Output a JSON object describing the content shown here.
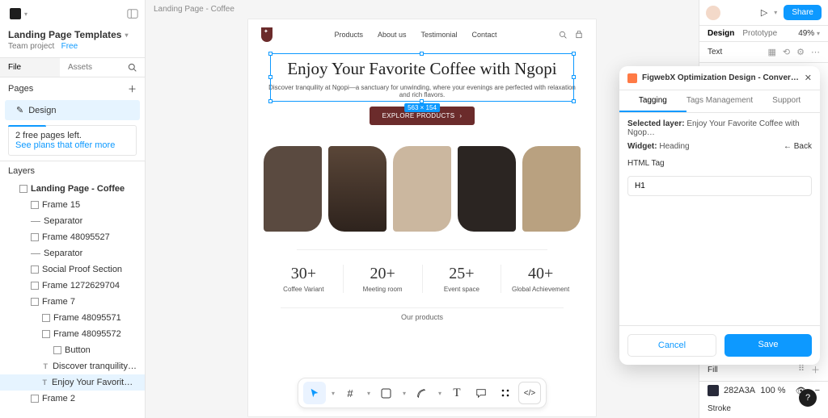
{
  "left": {
    "project_title": "Landing Page Templates",
    "team_label": "Team project",
    "free_label": "Free",
    "file_tab": "File",
    "assets_tab": "Assets",
    "pages_label": "Pages",
    "page_item": "Design",
    "notice_line1": "2 free pages left.",
    "notice_link": "See plans that offer more",
    "layers_label": "Layers",
    "layers": [
      {
        "label": "Landing Page - Coffee",
        "depth": 0,
        "icon": "frame",
        "sel": false,
        "bold": true
      },
      {
        "label": "Frame 15",
        "depth": 1,
        "icon": "frame"
      },
      {
        "label": "Separator",
        "depth": 1,
        "icon": "sep"
      },
      {
        "label": "Frame 48095527",
        "depth": 1,
        "icon": "frame"
      },
      {
        "label": "Separator",
        "depth": 1,
        "icon": "sep"
      },
      {
        "label": "Social Proof Section",
        "depth": 1,
        "icon": "frame"
      },
      {
        "label": "Frame 1272629704",
        "depth": 1,
        "icon": "frame"
      },
      {
        "label": "Frame 7",
        "depth": 1,
        "icon": "frame"
      },
      {
        "label": "Frame 48095571",
        "depth": 2,
        "icon": "frame"
      },
      {
        "label": "Frame 48095572",
        "depth": 2,
        "icon": "frame"
      },
      {
        "label": "Button",
        "depth": 3,
        "icon": "frame"
      },
      {
        "label": "Discover tranquility at Ngopi",
        "depth": 3,
        "icon": "text"
      },
      {
        "label": "Enjoy Your Favorite Coffee w",
        "depth": 3,
        "icon": "text",
        "sel": true
      },
      {
        "label": "Frame 2",
        "depth": 1,
        "icon": "frame"
      }
    ]
  },
  "canvas": {
    "tab": "Landing Page - Coffee",
    "nav": [
      "Products",
      "About us",
      "Testimonial",
      "Contact"
    ],
    "hero_title": "Enjoy Your Favorite Coffee with Ngopi",
    "sel_dim": "563 × 154",
    "hero_sub": "Discover tranquility at Ngopi—a sanctuary for unwinding, where your evenings are perfected with relaxation and rich flavors.",
    "cta": "EXPLORE PRODUCTS",
    "stats": [
      {
        "n": "30+",
        "l": "Coffee Variant"
      },
      {
        "n": "20+",
        "l": "Meeting room"
      },
      {
        "n": "25+",
        "l": "Event space"
      },
      {
        "n": "40+",
        "l": "Global Achievement"
      }
    ],
    "our_products": "Our products",
    "toolbar_icons": [
      "cursor",
      "frame",
      "square",
      "pen",
      "text",
      "comment",
      "plugins",
      "dev"
    ]
  },
  "right": {
    "share": "Share",
    "tab_design": "Design",
    "tab_proto": "Prototype",
    "zoom": "49%",
    "text_label": "Text",
    "fill_label": "Fill",
    "fill_hex": "282A3A",
    "fill_pct": "100",
    "stroke_label": "Stroke"
  },
  "plugin": {
    "title": "FigwebX Optimization Design - Convert Figma to your Pa…",
    "tabs": [
      "Tagging",
      "Tags Management",
      "Support"
    ],
    "selected_layer_label": "Selected layer:",
    "selected_layer_value": "Enjoy Your Favorite Coffee with Ngop…",
    "widget_label": "Widget:",
    "widget_value": "Heading",
    "back": "Back",
    "html_tag_label": "HTML Tag",
    "html_tag_value": "H1",
    "cancel": "Cancel",
    "save": "Save"
  }
}
